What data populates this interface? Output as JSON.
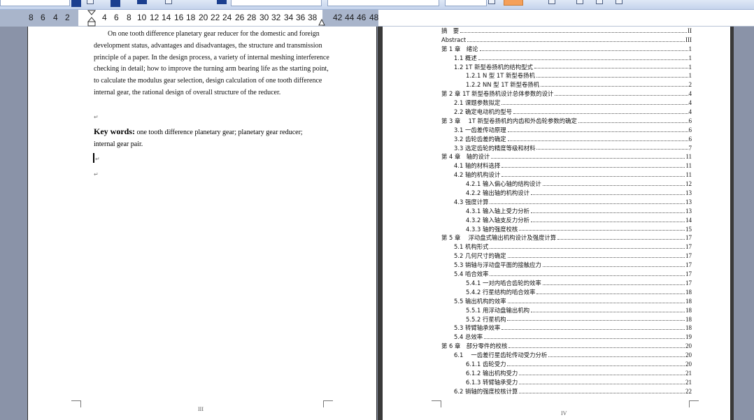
{
  "ruler": {
    "numbers": [
      "8",
      "6",
      "4",
      "2",
      "4",
      "6",
      "8",
      "10",
      "12",
      "14",
      "16",
      "18",
      "20",
      "22",
      "24",
      "26",
      "28",
      "30",
      "32",
      "34",
      "36",
      "38",
      "42",
      "44",
      "46",
      "48"
    ]
  },
  "left_page": {
    "abstract_text": "On one tooth difference planetary gear reducer for the domestic and foreign development status, advantages and disadvantages, the structure and transmission principle of a paper. In the design process, a variety of internal meshing interference checking in detail; how to improve the turning arm bearing life as the starting point, to calculate the modulus gear selection, design calculation of one tooth difference internal gear, the rational design of overall structure of the reducer.",
    "para_mark": "↵",
    "keywords_label": "Key words:",
    "keywords_text": "one tooth difference planetary gear; planetary gear reducer; internal gear pair.",
    "page_number": "III"
  },
  "right_page": {
    "page_number": "IV",
    "toc": [
      {
        "text": "摘　要",
        "page": "II",
        "level": 1
      },
      {
        "text": "Abstract",
        "page": "III",
        "level": 1
      },
      {
        "text": "第 1 章　绪论",
        "page": "1",
        "level": 1
      },
      {
        "text": "1.1  概述",
        "page": "1",
        "level": 2
      },
      {
        "text": "1.2 1T 新型卷扬机的结构型式",
        "page": "1",
        "level": 2
      },
      {
        "text": "1.2.1 N 型 1T 新型卷扬机",
        "page": "1",
        "level": 3
      },
      {
        "text": "1.2.2 NN 型 1T 新型卷扬机",
        "page": "2",
        "level": 3
      },
      {
        "text": "第 2 章  1T 新型卷扬机设计总体参数的设计",
        "page": "4",
        "level": 1
      },
      {
        "text": "2.1  课题参数拟定",
        "page": "4",
        "level": 2
      },
      {
        "text": "2.2  确定电动机的型号",
        "page": "4",
        "level": 2
      },
      {
        "text": "第 3 章　 1T 新型卷扬机的内齿和外齿轮参数的确定",
        "page": "6",
        "level": 1
      },
      {
        "text": "3.1 一齿差传动原理",
        "page": "6",
        "level": 2
      },
      {
        "text": "3.2  齿轮齿差的确定",
        "page": "6",
        "level": 2
      },
      {
        "text": "3.3  选定齿轮的精度等级和材料",
        "page": "7",
        "level": 2
      },
      {
        "text": "第 4 章　轴的设计",
        "page": "11",
        "level": 1
      },
      {
        "text": "4.1  轴的材料选择",
        "page": "11",
        "level": 2
      },
      {
        "text": "4.2  轴的机构设计",
        "page": "11",
        "level": 2
      },
      {
        "text": "4.2.1  输入偏心轴的结构设计",
        "page": "12",
        "level": 3
      },
      {
        "text": "4.2.2  输出轴的机构设计",
        "page": "13",
        "level": 3
      },
      {
        "text": "4.3  强度计算",
        "page": "13",
        "level": 2
      },
      {
        "text": "4.3.1  输入轴上受力分析",
        "page": "13",
        "level": 3
      },
      {
        "text": "4.3.2  输入轴支反力分析",
        "page": "14",
        "level": 3
      },
      {
        "text": "4.3.3  轴的强度校核",
        "page": "15",
        "level": 3
      },
      {
        "text": "第 5 章　 浮动盘式输出机构设计及强度计算",
        "page": "17",
        "level": 1
      },
      {
        "text": "5.1  机构形式",
        "page": "17",
        "level": 2
      },
      {
        "text": "5.2 几何尺寸的确定",
        "page": "17",
        "level": 2
      },
      {
        "text": "5.3  销轴与浮动盘平面的接触应力",
        "page": "17",
        "level": 2
      },
      {
        "text": "5.4  啮合效率",
        "page": "17",
        "level": 2
      },
      {
        "text": "5.4.1  一对内啮合齿轮的效率",
        "page": "17",
        "level": 3
      },
      {
        "text": "5.4.2  行星结构的啮合效率",
        "page": "18",
        "level": 3
      },
      {
        "text": "5.5  输出机构的效率",
        "page": "18",
        "level": 2
      },
      {
        "text": "5.5.1  用浮动盘输出机构",
        "page": "18",
        "level": 3
      },
      {
        "text": "5.5.2  行星机构",
        "page": "18",
        "level": 3
      },
      {
        "text": "5.3  转臂轴承效率",
        "page": "18",
        "level": 2
      },
      {
        "text": "5.4  总效率",
        "page": "19",
        "level": 2
      },
      {
        "text": "第 6 章　部分零件的校核",
        "page": "20",
        "level": 1
      },
      {
        "text": "6.1　 一齿差行星齿轮传动受力分析",
        "page": "20",
        "level": 2
      },
      {
        "text": "6.1.1    齿轮受力",
        "page": "20",
        "level": 3
      },
      {
        "text": "6.1.2    输出机构受力",
        "page": "21",
        "level": 3
      },
      {
        "text": "6.1.3    转臂轴承受力",
        "page": "21",
        "level": 3
      },
      {
        "text": "6.2  销轴的强度校核计算",
        "page": "22",
        "level": 2
      }
    ]
  }
}
